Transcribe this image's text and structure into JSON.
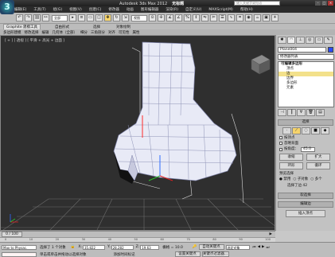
{
  "app": {
    "logo_text": "3",
    "title": "Autodesk 3ds Max 2012",
    "filename": "无标题",
    "search_placeholder": "键入关键字或短语"
  },
  "window_buttons": [
    "–",
    "□",
    "✕"
  ],
  "menu": [
    "编辑(E)",
    "工具(T)",
    "组(G)",
    "视图(V)",
    "创建(C)",
    "修改器",
    "动画",
    "图形编辑器",
    "渲染(R)",
    "自定义(U)",
    "MAXScript(M)",
    "帮助(H)"
  ],
  "toolbar": {
    "filter_value": "全部",
    "view_value": "视图"
  },
  "ribbon": {
    "active_tab": "Graphite 建模工具",
    "tab2": "自由形式",
    "tab3": "选择",
    "tab4": "对象绘制"
  },
  "subribbon": [
    "多边形建模",
    "修改选择",
    "编辑",
    "几何体（全部）",
    "细分",
    "三角剖分",
    "对齐",
    "可见性",
    "属性"
  ],
  "viewport": {
    "label": "[ + ] [ 透视 ] [ 平滑 + 高光 + 边面 ]"
  },
  "command_panel": {
    "object_name": "Plane004",
    "modifier_list": "修改器列表",
    "stack": [
      "可编辑多边形",
      "顶点",
      "边",
      "边界",
      "多边形",
      "元素"
    ],
    "selected_stack_index": 2,
    "rollout_title": "选择",
    "by_vertex": "按顶点",
    "ignore_backfacing": "忽略背面",
    "by_angle": "按角度：",
    "angle_value": "45.0",
    "shrink": "收缩",
    "grow": "扩大",
    "ring": "环形",
    "loop": "循环",
    "preview_title": "预览选择",
    "preview_off": "禁用",
    "preview_sub": "子对象",
    "preview_multi": "多个",
    "selected_text": "选择了边 42",
    "soft_sel": "软选择",
    "edit_edges": "编辑边",
    "insert_vertex": "插入顶点"
  },
  "timeline": {
    "frame": "0 / 100",
    "ticks": [
      "0",
      "10",
      "20",
      "30",
      "40",
      "50",
      "60",
      "70",
      "80",
      "90",
      "100"
    ]
  },
  "status": {
    "script_label": "Max to Physac.",
    "selection_info": "选择了 1 个对象",
    "prompt": "单击或单击并拖动以选择对象",
    "x_label": "X:",
    "x_value": "35.822",
    "y_label": "Y:",
    "y_value": "28.282",
    "z_label": "Z:",
    "z_value": "19.63",
    "grid_text": "栅格 = 10.0",
    "add_time_tag": "添加时间标记",
    "auto_key": "自动关键点",
    "selected_object": "选定对象",
    "set_key": "设置关键点",
    "key_filters": "关键点过滤器..."
  }
}
